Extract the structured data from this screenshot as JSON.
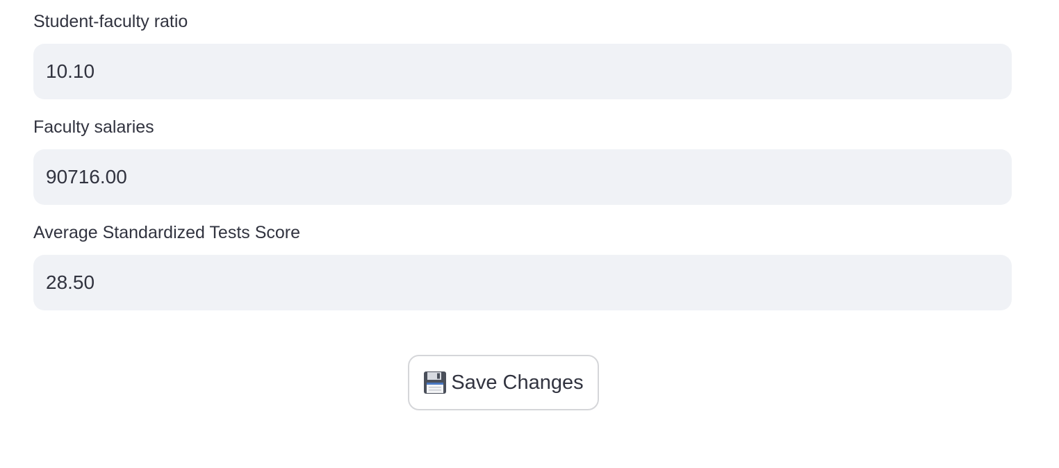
{
  "form": {
    "fields": [
      {
        "label": "Student-faculty ratio",
        "value": "10.10"
      },
      {
        "label": "Faculty salaries",
        "value": "90716.00"
      },
      {
        "label": "Average Standardized Tests Score",
        "value": "28.50"
      }
    ],
    "save_button": {
      "icon": "floppy-disk-icon",
      "label": "Save Changes"
    }
  },
  "colors": {
    "text": "#31333f",
    "input_background": "#f0f2f6",
    "button_border": "#d5d6d9",
    "page_background": "#ffffff"
  }
}
